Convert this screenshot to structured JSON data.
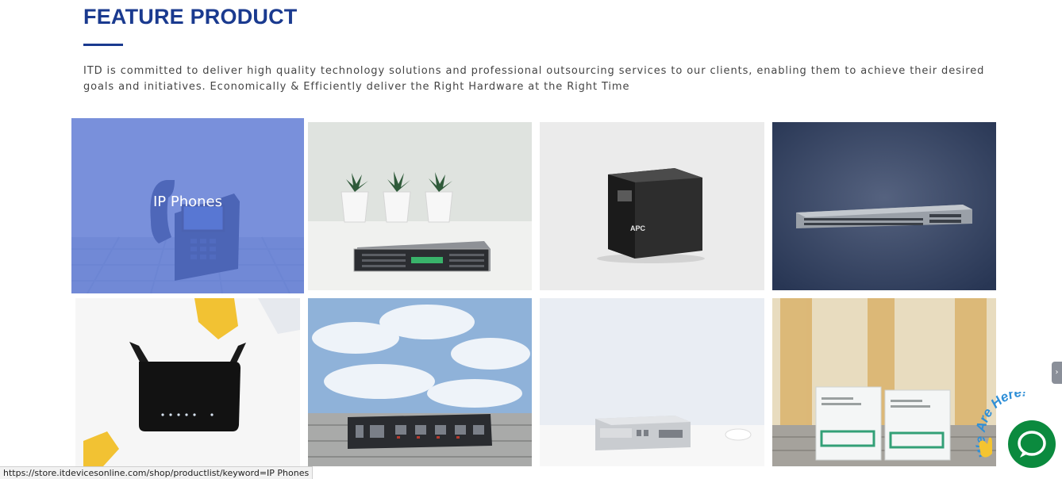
{
  "section": {
    "title": "FEATURE PRODUCT",
    "intro": "ITD is committed to deliver high quality technology solutions and professional outsourcing services to our clients, enabling them to achieve their desired goals and initiatives. Economically & Efficiently deliver the Right Hardware at the Right Time"
  },
  "tiles": [
    {
      "label": "IP Phones",
      "icon": "ip-phone"
    },
    {
      "icon": "rack-server"
    },
    {
      "icon": "ups-battery"
    },
    {
      "icon": "network-switch"
    },
    {
      "icon": "wireless-router"
    },
    {
      "icon": "kvm-switch"
    },
    {
      "icon": "firewall-appliance"
    },
    {
      "icon": "lto-tape-cartridge"
    }
  ],
  "status_bar": {
    "url": "https://store.itdevicesonline.com/shop/productlist/keyword=IP Phones"
  },
  "chat": {
    "badge_text": "We Are Here!",
    "icon": "chat-bubble"
  },
  "colors": {
    "brand_blue": "#1a3a8f",
    "hover_overlay": "#5c78d6",
    "chat_green": "#0b8a3e"
  }
}
